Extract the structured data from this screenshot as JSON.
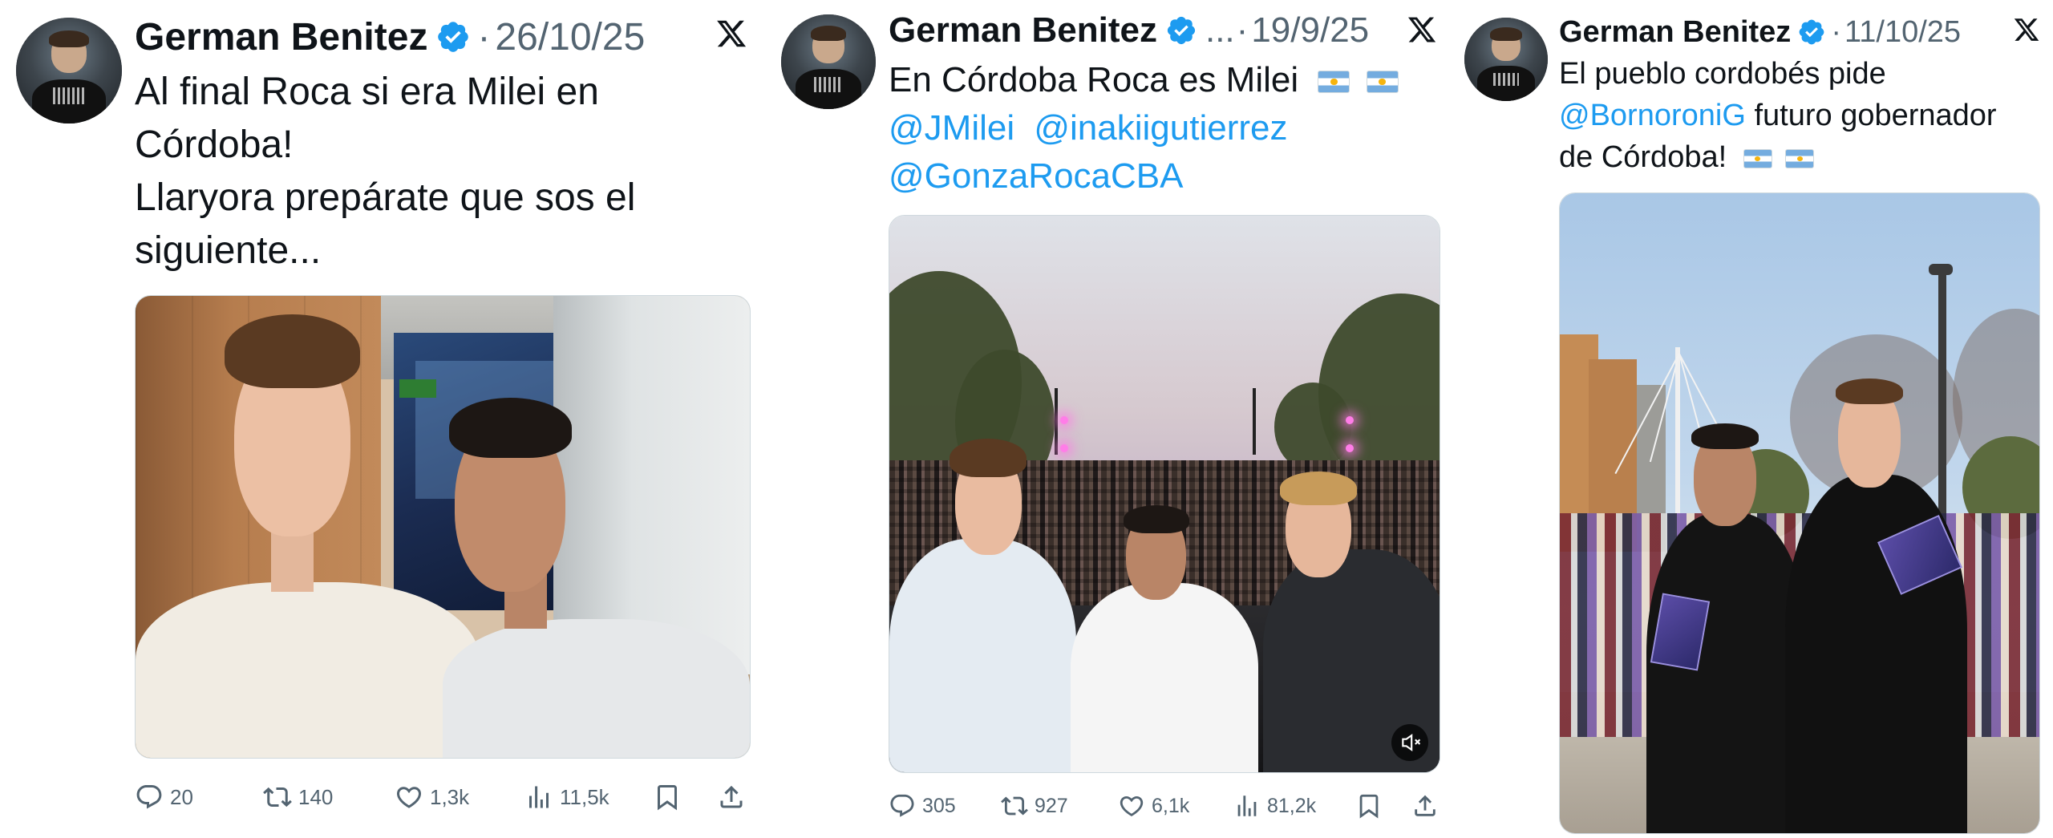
{
  "tweets": [
    {
      "author": "German Benitez",
      "separator": "·",
      "date": "26/10/25",
      "platform_icon": "x-logo",
      "text_lines": [
        "Al final Roca si era Milei en",
        "Córdoba!",
        "Llaryora prepárate que sos el",
        "siguiente..."
      ],
      "actions": {
        "replies": "20",
        "reposts": "140",
        "likes": "1,3k",
        "views": "11,5k"
      }
    },
    {
      "author": "German Benitez",
      "ellipsis": "...",
      "separator": "·",
      "date": "19/9/25",
      "platform_icon": "x-logo",
      "text_line1": "En Córdoba Roca es Milei",
      "mentions_line2": [
        "@JMilei",
        "@inakiigutierrez"
      ],
      "mentions_line3": [
        "@GonzaRocaCBA"
      ],
      "actions": {
        "replies": "305",
        "reposts": "927",
        "likes": "6,1k",
        "views": "81,2k"
      }
    },
    {
      "author": "German Benitez",
      "separator": "·",
      "date": "11/10/25",
      "platform_icon": "x-logo",
      "text_line1": "El pueblo cordobés pide",
      "mention": "@BornoroniG",
      "text_line2_rest": " futuro gobernador",
      "text_line3": "de Córdoba!"
    }
  ],
  "colors": {
    "text": "#0f1419",
    "secondary": "#536471",
    "link": "#1d9bf0",
    "verified": "#1d9bf0"
  }
}
